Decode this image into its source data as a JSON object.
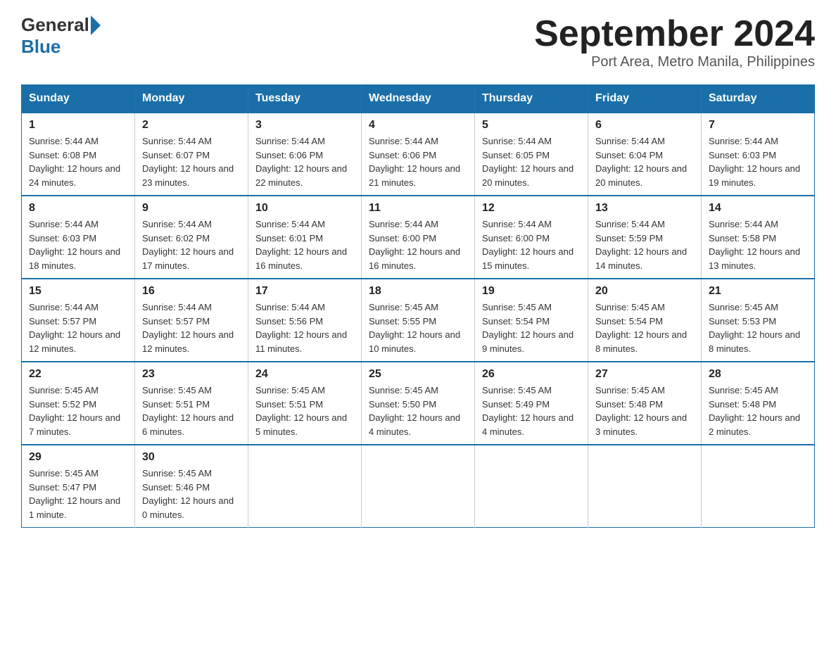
{
  "logo": {
    "general": "General",
    "blue": "Blue"
  },
  "title": "September 2024",
  "subtitle": "Port Area, Metro Manila, Philippines",
  "days_of_week": [
    "Sunday",
    "Monday",
    "Tuesday",
    "Wednesday",
    "Thursday",
    "Friday",
    "Saturday"
  ],
  "weeks": [
    [
      {
        "day": "1",
        "sunrise": "5:44 AM",
        "sunset": "6:08 PM",
        "daylight": "12 hours and 24 minutes."
      },
      {
        "day": "2",
        "sunrise": "5:44 AM",
        "sunset": "6:07 PM",
        "daylight": "12 hours and 23 minutes."
      },
      {
        "day": "3",
        "sunrise": "5:44 AM",
        "sunset": "6:06 PM",
        "daylight": "12 hours and 22 minutes."
      },
      {
        "day": "4",
        "sunrise": "5:44 AM",
        "sunset": "6:06 PM",
        "daylight": "12 hours and 21 minutes."
      },
      {
        "day": "5",
        "sunrise": "5:44 AM",
        "sunset": "6:05 PM",
        "daylight": "12 hours and 20 minutes."
      },
      {
        "day": "6",
        "sunrise": "5:44 AM",
        "sunset": "6:04 PM",
        "daylight": "12 hours and 20 minutes."
      },
      {
        "day": "7",
        "sunrise": "5:44 AM",
        "sunset": "6:03 PM",
        "daylight": "12 hours and 19 minutes."
      }
    ],
    [
      {
        "day": "8",
        "sunrise": "5:44 AM",
        "sunset": "6:03 PM",
        "daylight": "12 hours and 18 minutes."
      },
      {
        "day": "9",
        "sunrise": "5:44 AM",
        "sunset": "6:02 PM",
        "daylight": "12 hours and 17 minutes."
      },
      {
        "day": "10",
        "sunrise": "5:44 AM",
        "sunset": "6:01 PM",
        "daylight": "12 hours and 16 minutes."
      },
      {
        "day": "11",
        "sunrise": "5:44 AM",
        "sunset": "6:00 PM",
        "daylight": "12 hours and 16 minutes."
      },
      {
        "day": "12",
        "sunrise": "5:44 AM",
        "sunset": "6:00 PM",
        "daylight": "12 hours and 15 minutes."
      },
      {
        "day": "13",
        "sunrise": "5:44 AM",
        "sunset": "5:59 PM",
        "daylight": "12 hours and 14 minutes."
      },
      {
        "day": "14",
        "sunrise": "5:44 AM",
        "sunset": "5:58 PM",
        "daylight": "12 hours and 13 minutes."
      }
    ],
    [
      {
        "day": "15",
        "sunrise": "5:44 AM",
        "sunset": "5:57 PM",
        "daylight": "12 hours and 12 minutes."
      },
      {
        "day": "16",
        "sunrise": "5:44 AM",
        "sunset": "5:57 PM",
        "daylight": "12 hours and 12 minutes."
      },
      {
        "day": "17",
        "sunrise": "5:44 AM",
        "sunset": "5:56 PM",
        "daylight": "12 hours and 11 minutes."
      },
      {
        "day": "18",
        "sunrise": "5:45 AM",
        "sunset": "5:55 PM",
        "daylight": "12 hours and 10 minutes."
      },
      {
        "day": "19",
        "sunrise": "5:45 AM",
        "sunset": "5:54 PM",
        "daylight": "12 hours and 9 minutes."
      },
      {
        "day": "20",
        "sunrise": "5:45 AM",
        "sunset": "5:54 PM",
        "daylight": "12 hours and 8 minutes."
      },
      {
        "day": "21",
        "sunrise": "5:45 AM",
        "sunset": "5:53 PM",
        "daylight": "12 hours and 8 minutes."
      }
    ],
    [
      {
        "day": "22",
        "sunrise": "5:45 AM",
        "sunset": "5:52 PM",
        "daylight": "12 hours and 7 minutes."
      },
      {
        "day": "23",
        "sunrise": "5:45 AM",
        "sunset": "5:51 PM",
        "daylight": "12 hours and 6 minutes."
      },
      {
        "day": "24",
        "sunrise": "5:45 AM",
        "sunset": "5:51 PM",
        "daylight": "12 hours and 5 minutes."
      },
      {
        "day": "25",
        "sunrise": "5:45 AM",
        "sunset": "5:50 PM",
        "daylight": "12 hours and 4 minutes."
      },
      {
        "day": "26",
        "sunrise": "5:45 AM",
        "sunset": "5:49 PM",
        "daylight": "12 hours and 4 minutes."
      },
      {
        "day": "27",
        "sunrise": "5:45 AM",
        "sunset": "5:48 PM",
        "daylight": "12 hours and 3 minutes."
      },
      {
        "day": "28",
        "sunrise": "5:45 AM",
        "sunset": "5:48 PM",
        "daylight": "12 hours and 2 minutes."
      }
    ],
    [
      {
        "day": "29",
        "sunrise": "5:45 AM",
        "sunset": "5:47 PM",
        "daylight": "12 hours and 1 minute."
      },
      {
        "day": "30",
        "sunrise": "5:45 AM",
        "sunset": "5:46 PM",
        "daylight": "12 hours and 0 minutes."
      },
      null,
      null,
      null,
      null,
      null
    ]
  ],
  "labels": {
    "sunrise": "Sunrise:",
    "sunset": "Sunset:",
    "daylight": "Daylight:"
  }
}
